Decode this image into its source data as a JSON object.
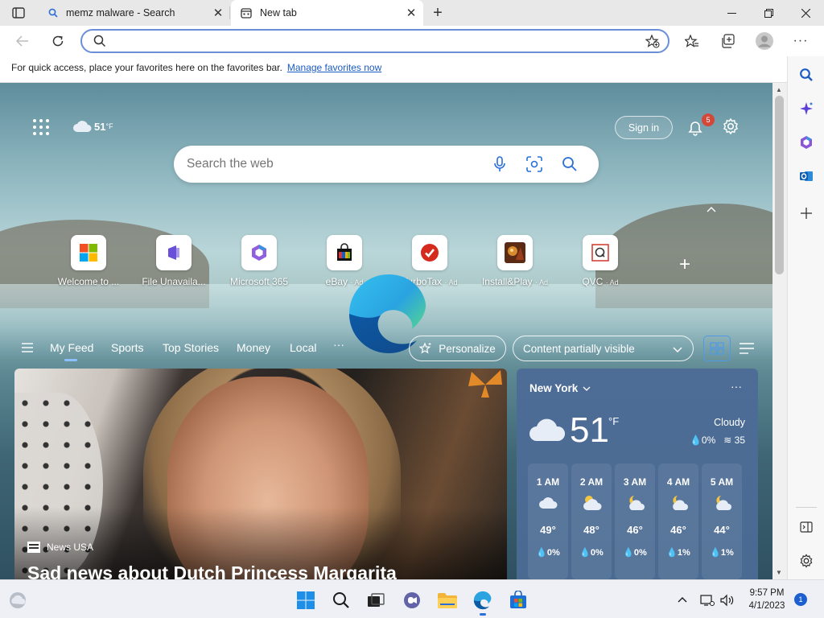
{
  "tabs": [
    {
      "title": "memz malware - Search",
      "icon": "search-icon"
    },
    {
      "title": "New tab",
      "icon": "newtab-icon"
    }
  ],
  "address": {
    "value": "",
    "placeholder": ""
  },
  "favorites_bar": {
    "message": "For quick access, place your favorites here on the favorites bar.",
    "link": "Manage favorites now"
  },
  "ntp": {
    "weather_mini": {
      "temp": "51",
      "unit": "°F"
    },
    "sign_in": "Sign in",
    "notifications_count": "5",
    "search_placeholder": "Search the web",
    "quick_links": [
      {
        "label": "Welcome to ...",
        "ad": ""
      },
      {
        "label": "File Unavaila...",
        "ad": ""
      },
      {
        "label": "Microsoft 365",
        "ad": ""
      },
      {
        "label": "eBay",
        "ad": "· Ad"
      },
      {
        "label": "TurboTax",
        "ad": "· Ad"
      },
      {
        "label": "Install&Play",
        "ad": "· Ad"
      },
      {
        "label": "QVC",
        "ad": "· Ad"
      }
    ],
    "feed_nav": [
      "My Feed",
      "Sports",
      "Top Stories",
      "Money",
      "Local"
    ],
    "feed_more": "···",
    "personalize": "Personalize",
    "content_visibility": "Content partially visible",
    "hero": {
      "source": "News USA",
      "title": "Sad news about Dutch Princess Margarita"
    },
    "weather": {
      "city": "New York",
      "more": "···",
      "temp": "51",
      "unit": "°F",
      "condition": "Cloudy",
      "precip": "0%",
      "wind": "35",
      "hourly": [
        {
          "time": "1 AM",
          "temp": "49°",
          "precip": "0%",
          "icon": "cloud-icon"
        },
        {
          "time": "2 AM",
          "temp": "48°",
          "precip": "0%",
          "icon": "cloud-sun-icon"
        },
        {
          "time": "3 AM",
          "temp": "46°",
          "precip": "0%",
          "icon": "cloud-moon-icon"
        },
        {
          "time": "4 AM",
          "temp": "46°",
          "precip": "1%",
          "icon": "cloud-moon-icon"
        },
        {
          "time": "5 AM",
          "temp": "44°",
          "precip": "1%",
          "icon": "cloud-moon-icon"
        }
      ]
    }
  },
  "taskbar": {
    "time": "9:57 PM",
    "date": "4/1/2023",
    "notification_count": "1"
  },
  "colors": {
    "accent": "#2a6fd8",
    "address_border": "#6a8fd8",
    "badge": "#d4483a",
    "weather_card": "#4d6d96"
  }
}
